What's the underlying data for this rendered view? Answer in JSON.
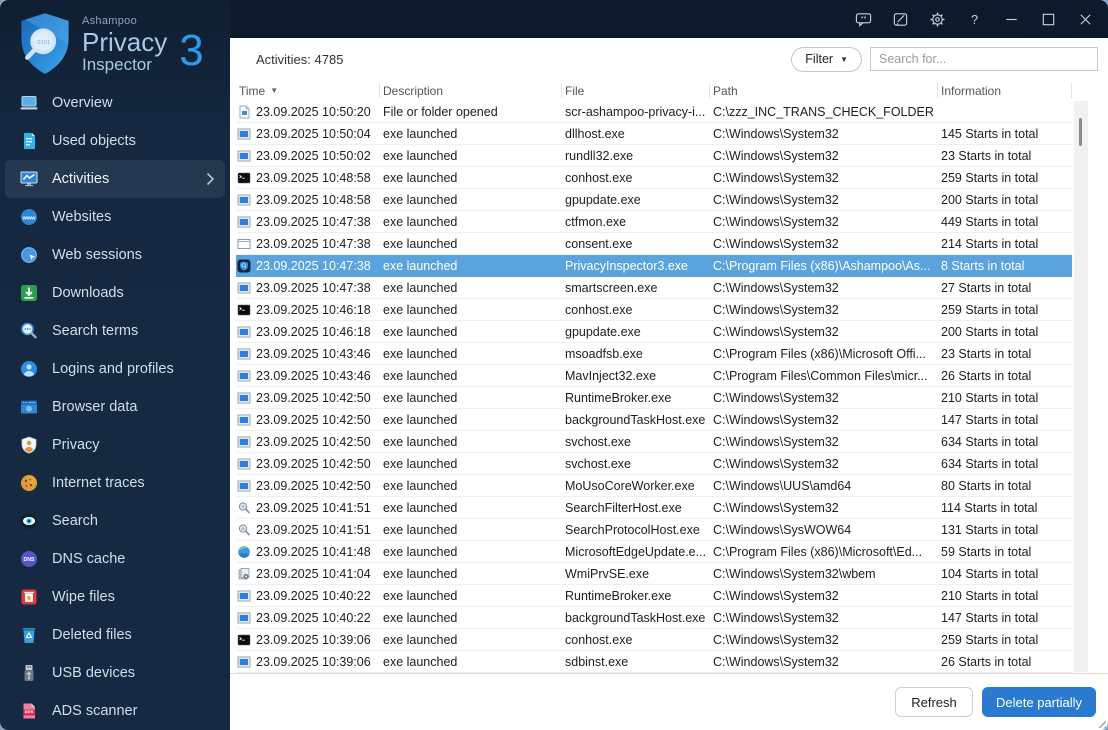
{
  "colors": {
    "accent": "#2a7ad0",
    "selection": "#5ba3dc",
    "sidebar_bg": "#15283f",
    "titlebar_bg": "#0c1a2c"
  },
  "logo": {
    "brand": "Ashampoo",
    "product_line1": "Privacy",
    "product_line2": "Inspector",
    "version": "3",
    "icon": "privacy-inspector-shield-logo"
  },
  "titlebar": {
    "icons": [
      {
        "name": "feedback-icon"
      },
      {
        "name": "notes-icon"
      },
      {
        "name": "settings-gear-icon"
      },
      {
        "name": "help-icon"
      },
      {
        "name": "minimize-icon"
      },
      {
        "name": "maximize-icon"
      },
      {
        "name": "close-icon"
      }
    ]
  },
  "sidebar": {
    "items": [
      {
        "label": "Overview",
        "icon": "overview-laptop-icon",
        "selected": false
      },
      {
        "label": "Used objects",
        "icon": "used-objects-icon",
        "selected": false
      },
      {
        "label": "Activities",
        "icon": "activities-chart-icon",
        "selected": true
      },
      {
        "label": "Websites",
        "icon": "websites-globe-icon",
        "selected": false
      },
      {
        "label": "Web sessions",
        "icon": "web-sessions-icon",
        "selected": false
      },
      {
        "label": "Downloads",
        "icon": "downloads-icon",
        "selected": false
      },
      {
        "label": "Search terms",
        "icon": "search-terms-icon",
        "selected": false
      },
      {
        "label": "Logins and profiles",
        "icon": "logins-profiles-icon",
        "selected": false
      },
      {
        "label": "Browser data",
        "icon": "browser-data-icon",
        "selected": false
      },
      {
        "label": "Privacy",
        "icon": "privacy-shield-person-icon",
        "selected": false
      },
      {
        "label": "Internet traces",
        "icon": "internet-traces-cookie-icon",
        "selected": false
      },
      {
        "label": "Search",
        "icon": "search-eye-icon",
        "selected": false
      },
      {
        "label": "DNS cache",
        "icon": "dns-cache-icon",
        "selected": false
      },
      {
        "label": "Wipe files",
        "icon": "wipe-files-icon",
        "selected": false
      },
      {
        "label": "Deleted files",
        "icon": "deleted-files-icon",
        "selected": false
      },
      {
        "label": "USB devices",
        "icon": "usb-devices-icon",
        "selected": false
      },
      {
        "label": "ADS scanner",
        "icon": "ads-scanner-icon",
        "selected": false
      }
    ]
  },
  "header": {
    "activities_count_label": "Activities: 4785",
    "filter_label": "Filter",
    "search_placeholder": "Search for..."
  },
  "table": {
    "columns": [
      "Time",
      "Description",
      "File",
      "Path",
      "Information"
    ],
    "sort_column": "Time",
    "sort_direction": "desc",
    "rows": [
      {
        "icon": "file-doc-icon",
        "time": "23.09.2025 10:50:20",
        "description": "File or folder opened",
        "file": "scr-ashampoo-privacy-i...",
        "path": "C:\\zzz_INC_TRANS_CHECK_FOLDER",
        "information": "",
        "selected": false
      },
      {
        "icon": "app-window-icon",
        "time": "23.09.2025 10:50:04",
        "description": "exe launched",
        "file": "dllhost.exe",
        "path": "C:\\Windows\\System32",
        "information": "145 Starts in total",
        "selected": false
      },
      {
        "icon": "app-window-icon",
        "time": "23.09.2025 10:50:02",
        "description": "exe launched",
        "file": "rundll32.exe",
        "path": "C:\\Windows\\System32",
        "information": "23 Starts in total",
        "selected": false
      },
      {
        "icon": "console-icon",
        "time": "23.09.2025 10:48:58",
        "description": "exe launched",
        "file": "conhost.exe",
        "path": "C:\\Windows\\System32",
        "information": "259 Starts in total",
        "selected": false
      },
      {
        "icon": "app-window-icon",
        "time": "23.09.2025 10:48:58",
        "description": "exe launched",
        "file": "gpupdate.exe",
        "path": "C:\\Windows\\System32",
        "information": "200 Starts in total",
        "selected": false
      },
      {
        "icon": "app-window-icon",
        "time": "23.09.2025 10:47:38",
        "description": "exe launched",
        "file": "ctfmon.exe",
        "path": "C:\\Windows\\System32",
        "information": "449 Starts in total",
        "selected": false
      },
      {
        "icon": "plain-window-icon",
        "time": "23.09.2025 10:47:38",
        "description": "exe launched",
        "file": "consent.exe",
        "path": "C:\\Windows\\System32",
        "information": "214 Starts in total",
        "selected": false
      },
      {
        "icon": "privacy-shield-icon",
        "time": "23.09.2025 10:47:38",
        "description": "exe launched",
        "file": "PrivacyInspector3.exe",
        "path": "C:\\Program Files (x86)\\Ashampoo\\As...",
        "information": "8 Starts in total",
        "selected": true
      },
      {
        "icon": "app-window-icon",
        "time": "23.09.2025 10:47:38",
        "description": "exe launched",
        "file": "smartscreen.exe",
        "path": "C:\\Windows\\System32",
        "information": "27 Starts in total",
        "selected": false
      },
      {
        "icon": "console-icon",
        "time": "23.09.2025 10:46:18",
        "description": "exe launched",
        "file": "conhost.exe",
        "path": "C:\\Windows\\System32",
        "information": "259 Starts in total",
        "selected": false
      },
      {
        "icon": "app-window-icon",
        "time": "23.09.2025 10:46:18",
        "description": "exe launched",
        "file": "gpupdate.exe",
        "path": "C:\\Windows\\System32",
        "information": "200 Starts in total",
        "selected": false
      },
      {
        "icon": "app-window-icon",
        "time": "23.09.2025 10:43:46",
        "description": "exe launched",
        "file": "msoadfsb.exe",
        "path": "C:\\Program Files (x86)\\Microsoft Offi...",
        "information": "23 Starts in total",
        "selected": false
      },
      {
        "icon": "app-window-icon",
        "time": "23.09.2025 10:43:46",
        "description": "exe launched",
        "file": "MavInject32.exe",
        "path": "C:\\Program Files\\Common Files\\micr...",
        "information": "26 Starts in total",
        "selected": false
      },
      {
        "icon": "app-window-icon",
        "time": "23.09.2025 10:42:50",
        "description": "exe launched",
        "file": "RuntimeBroker.exe",
        "path": "C:\\Windows\\System32",
        "information": "210 Starts in total",
        "selected": false
      },
      {
        "icon": "app-window-icon",
        "time": "23.09.2025 10:42:50",
        "description": "exe launched",
        "file": "backgroundTaskHost.exe",
        "path": "C:\\Windows\\System32",
        "information": "147 Starts in total",
        "selected": false
      },
      {
        "icon": "app-window-icon",
        "time": "23.09.2025 10:42:50",
        "description": "exe launched",
        "file": "svchost.exe",
        "path": "C:\\Windows\\System32",
        "information": "634 Starts in total",
        "selected": false
      },
      {
        "icon": "app-window-icon",
        "time": "23.09.2025 10:42:50",
        "description": "exe launched",
        "file": "svchost.exe",
        "path": "C:\\Windows\\System32",
        "information": "634 Starts in total",
        "selected": false
      },
      {
        "icon": "app-window-icon",
        "time": "23.09.2025 10:42:50",
        "description": "exe launched",
        "file": "MoUsoCoreWorker.exe",
        "path": "C:\\Windows\\UUS\\amd64",
        "information": "80 Starts in total",
        "selected": false
      },
      {
        "icon": "search-host-icon",
        "time": "23.09.2025 10:41:51",
        "description": "exe launched",
        "file": "SearchFilterHost.exe",
        "path": "C:\\Windows\\System32",
        "information": "114 Starts in total",
        "selected": false
      },
      {
        "icon": "search-host-icon",
        "time": "23.09.2025 10:41:51",
        "description": "exe launched",
        "file": "SearchProtocolHost.exe",
        "path": "C:\\Windows\\SysWOW64",
        "information": "131 Starts in total",
        "selected": false
      },
      {
        "icon": "edge-update-icon",
        "time": "23.09.2025 10:41:48",
        "description": "exe launched",
        "file": "MicrosoftEdgeUpdate.e...",
        "path": "C:\\Program Files (x86)\\Microsoft\\Ed...",
        "information": "59 Starts in total",
        "selected": false
      },
      {
        "icon": "wmi-icon",
        "time": "23.09.2025 10:41:04",
        "description": "exe launched",
        "file": "WmiPrvSE.exe",
        "path": "C:\\Windows\\System32\\wbem",
        "information": "104 Starts in total",
        "selected": false
      },
      {
        "icon": "app-window-icon",
        "time": "23.09.2025 10:40:22",
        "description": "exe launched",
        "file": "RuntimeBroker.exe",
        "path": "C:\\Windows\\System32",
        "information": "210 Starts in total",
        "selected": false
      },
      {
        "icon": "app-window-icon",
        "time": "23.09.2025 10:40:22",
        "description": "exe launched",
        "file": "backgroundTaskHost.exe",
        "path": "C:\\Windows\\System32",
        "information": "147 Starts in total",
        "selected": false
      },
      {
        "icon": "console-icon",
        "time": "23.09.2025 10:39:06",
        "description": "exe launched",
        "file": "conhost.exe",
        "path": "C:\\Windows\\System32",
        "information": "259 Starts in total",
        "selected": false
      },
      {
        "icon": "app-window-icon",
        "time": "23.09.2025 10:39:06",
        "description": "exe launched",
        "file": "sdbinst.exe",
        "path": "C:\\Windows\\System32",
        "information": "26 Starts in total",
        "selected": false
      }
    ]
  },
  "footer": {
    "refresh_label": "Refresh",
    "delete_label": "Delete partially"
  }
}
